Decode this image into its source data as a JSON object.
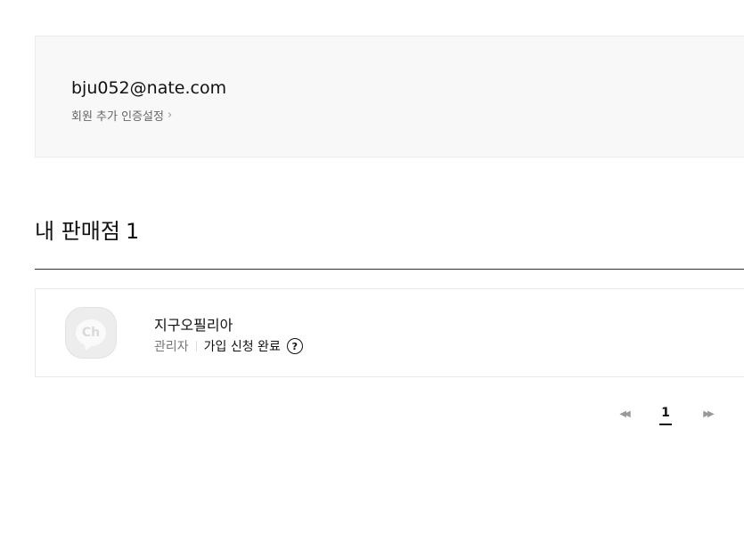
{
  "account": {
    "email": "bju052@nate.com",
    "auth_link_label": "회원 추가 인증설정",
    "auth_link_icon": "chevron-right-icon"
  },
  "stores_section": {
    "title": "내 판매점",
    "count": "1"
  },
  "stores": [
    {
      "name": "지구오필리아",
      "role": "관리자",
      "status": "가입 신청 완료",
      "avatar_text": "Ch",
      "help_symbol": "?"
    }
  ],
  "pagination": {
    "current_page": "1",
    "first_icon": "double-chevron-left-icon",
    "last_icon": "double-chevron-right-icon"
  }
}
